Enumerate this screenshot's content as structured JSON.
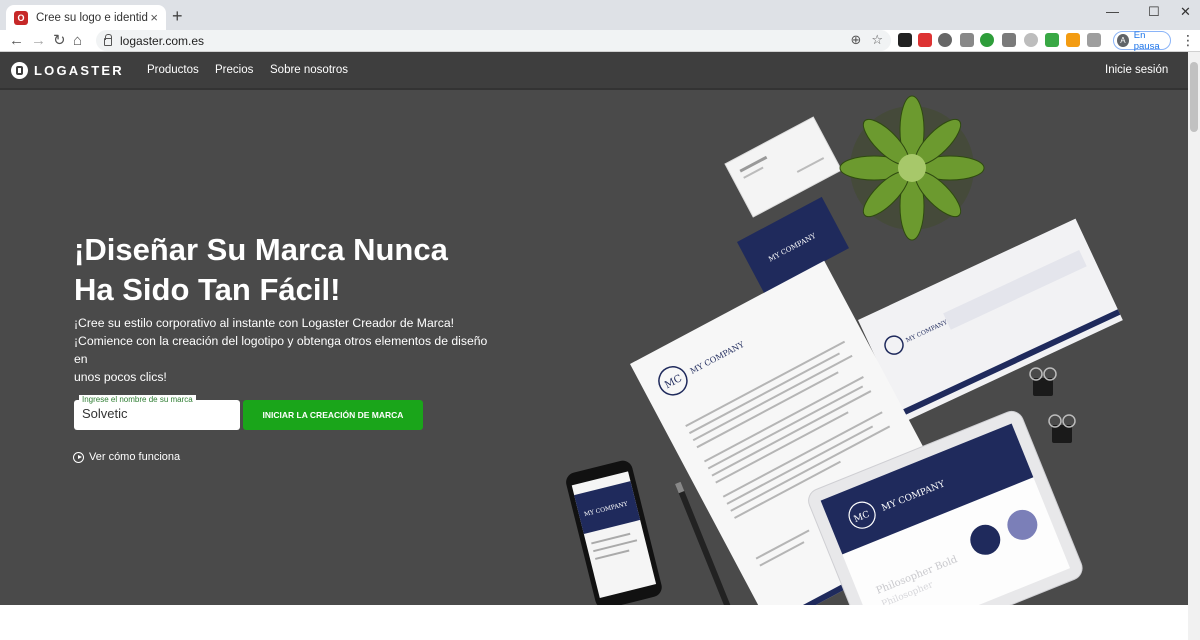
{
  "browser": {
    "tab_title": "Cree su logo e identidad corporativa",
    "tab_favicon": "logaster-favicon",
    "new_tab": "+",
    "url": "logaster.com.es",
    "profile_initial": "A",
    "profile_status": "En pausa",
    "window_controls": [
      "—",
      "☐",
      "✕"
    ]
  },
  "site": {
    "logo_text": "LOGASTER",
    "nav": [
      "Productos",
      "Precios",
      "Sobre nosotros"
    ],
    "login": "Inicie sesión",
    "hero": {
      "title_line1": "¡Diseñar Su Marca Nunca",
      "title_line2": "Ha Sido Tan Fácil!",
      "sub_line1": "¡Cree su estilo corporativo al instante con Logaster Creador de Marca!",
      "sub_line2": "¡Comience con la creación del logotipo y obtenga otros elementos de diseño en",
      "sub_line3": "unos pocos clics!",
      "input_label": "Ingrese el nombre de su marca",
      "input_value": "Solvetic",
      "cta": "INICIAR LA CREACIÓN DE MARCA",
      "howto": "Ver cómo funciona"
    },
    "mockup": {
      "company": "MY COMPANY",
      "monogram": "MC",
      "font_sample_1": "Philosopher Bold",
      "font_sample_2": "Philosopher"
    }
  },
  "colors": {
    "hero_bg": "#4a4a4a",
    "nav_bg": "#3e3e3e",
    "cta": "#1aa51a",
    "brand_navy": "#1f2a5c",
    "brand_lavender": "#7b7fb8"
  }
}
